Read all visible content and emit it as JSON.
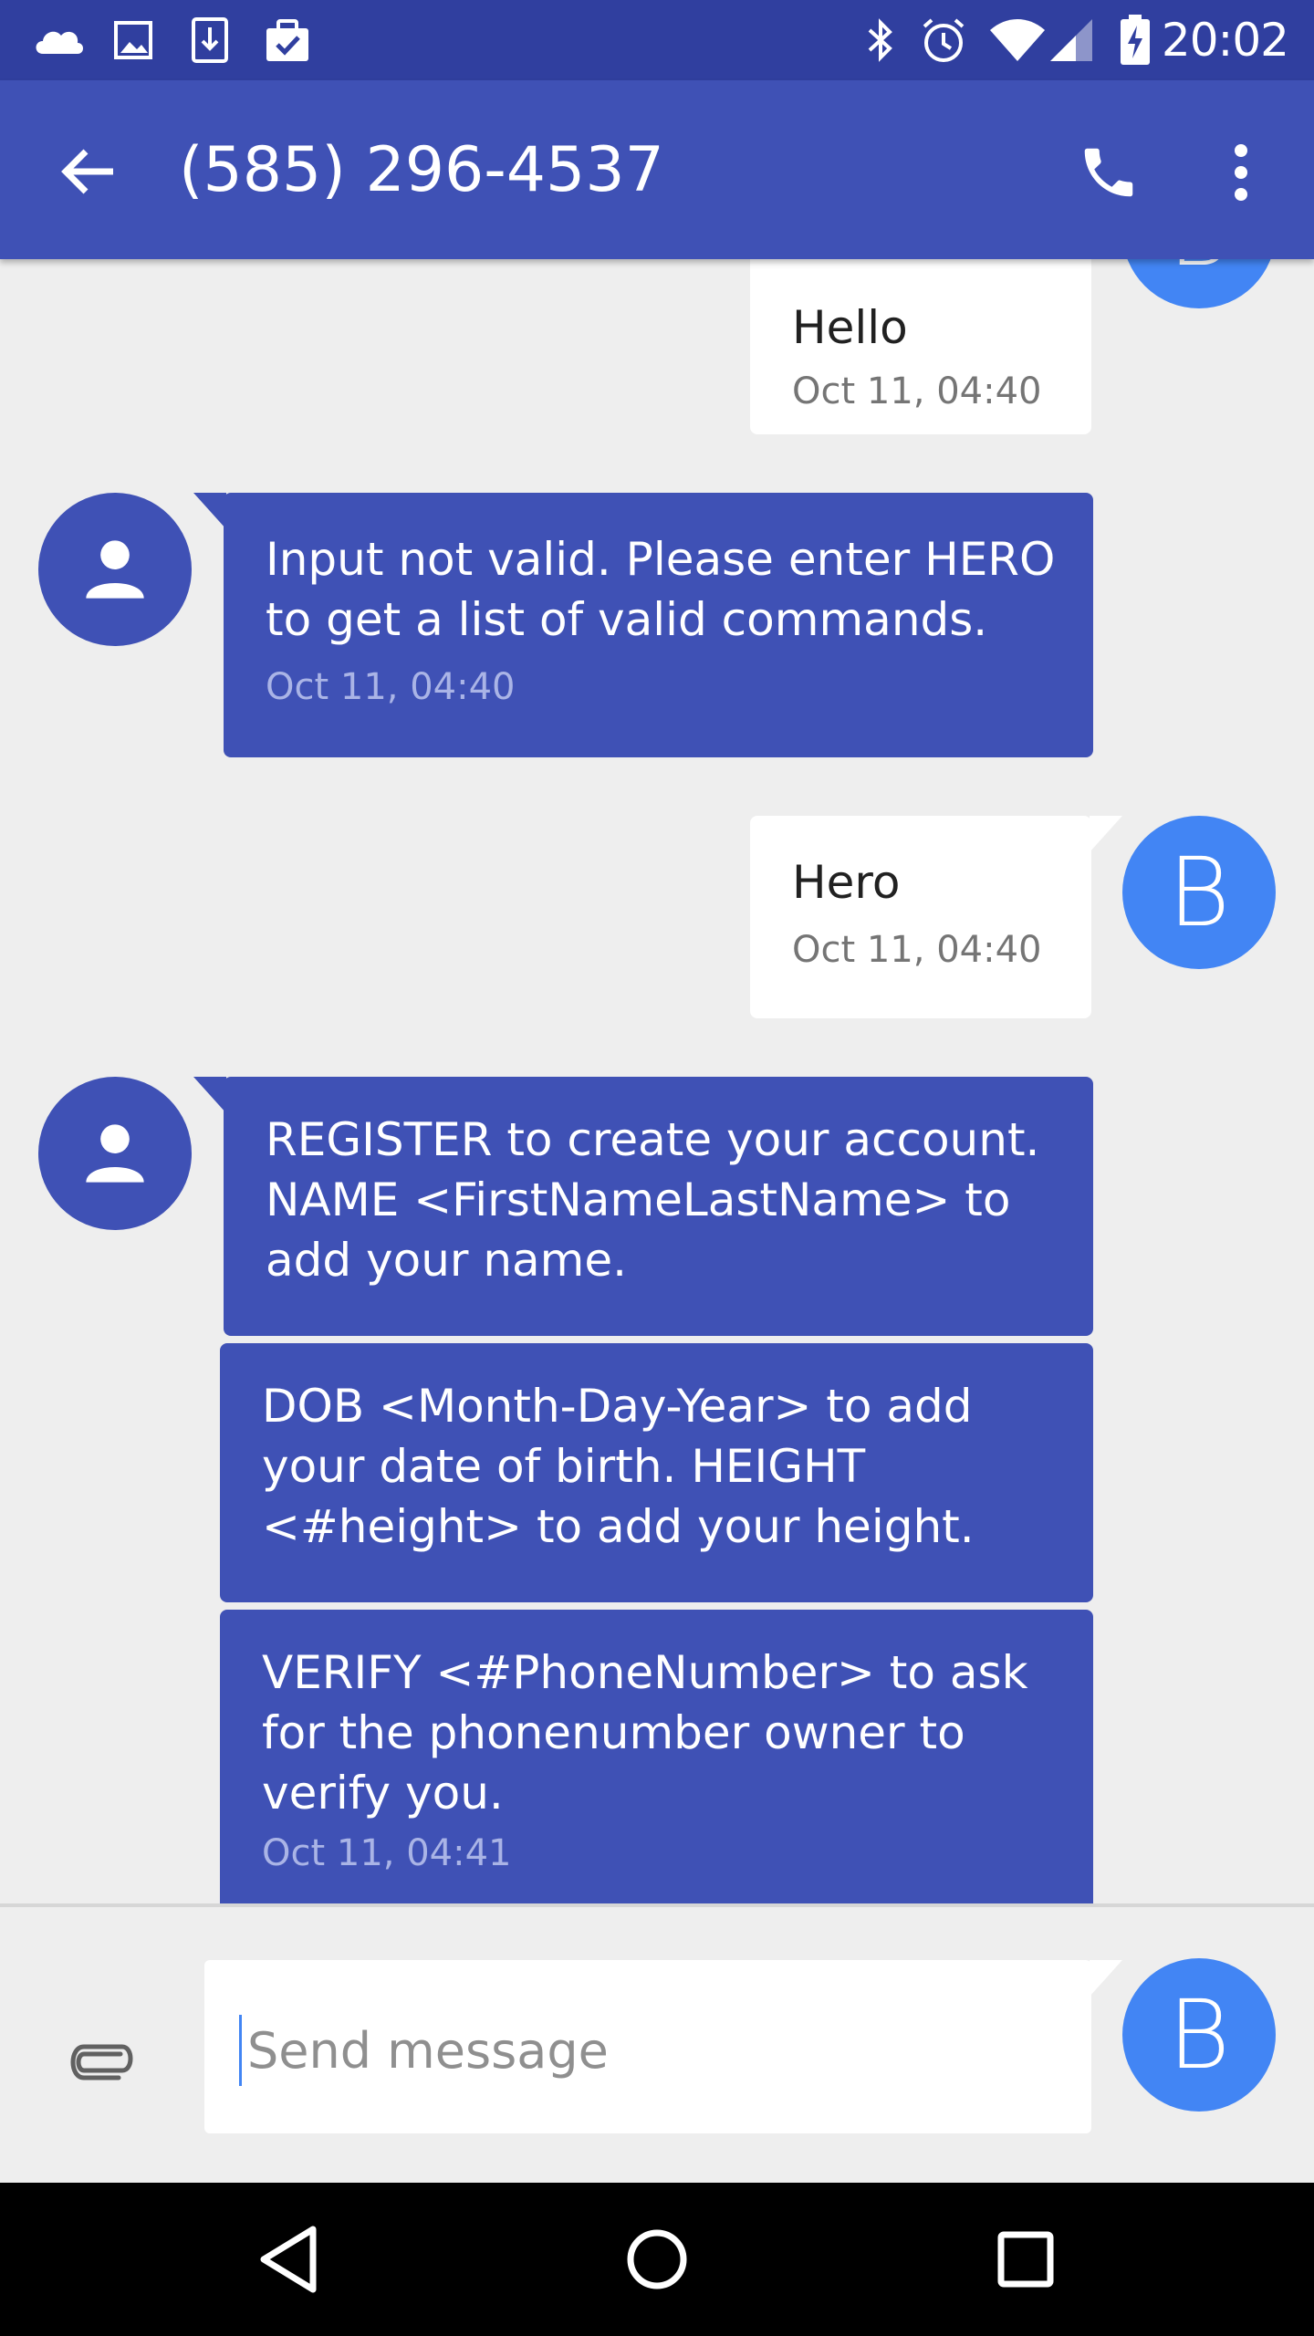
{
  "status_bar": {
    "time": "20:02",
    "icons": [
      "cloud-icon",
      "image-icon",
      "download-icon",
      "clipboard-check-icon",
      "bluetooth-icon",
      "alarm-icon",
      "wifi-icon",
      "signal-icon",
      "battery-charging-icon"
    ]
  },
  "app_bar": {
    "title": "(585) 296-4537",
    "icons": [
      "back-arrow-icon",
      "phone-icon",
      "more-vert-icon"
    ]
  },
  "contact_avatar_letter": "B",
  "messages": [
    {
      "direction": "outgoing",
      "text": "Hello",
      "timestamp": "Oct 11, 04:40"
    },
    {
      "direction": "incoming",
      "text": "Input not valid. Please enter HERO\nto get a list of valid commands.",
      "timestamp": "Oct 11, 04:40"
    },
    {
      "direction": "outgoing",
      "text": "Hero",
      "timestamp": "Oct 11, 04:40"
    },
    {
      "direction": "incoming",
      "text": "REGISTER to create your account.\nNAME <FirstNameLastName> to\nadd your name.",
      "timestamp": ""
    },
    {
      "direction": "incoming",
      "text": "DOB <Month-Day-Year> to add\nyour date of birth. HEIGHT\n<#height> to add your height.",
      "timestamp": ""
    },
    {
      "direction": "incoming",
      "text": "VERIFY <#PhoneNumber> to ask\nfor the phonenumber owner to\nverify you.",
      "timestamp": "Oct 11, 04:41"
    }
  ],
  "compose": {
    "placeholder": "Send message",
    "value": ""
  },
  "colors": {
    "status_bar": "#303f9f",
    "app_bar": "#3f51b5",
    "incoming_bubble": "#3f51b5",
    "outgoing_bubble": "#ffffff",
    "my_avatar": "#4285f4",
    "background": "#eeeeee"
  },
  "nav_bar": {
    "icons": [
      "nav-back-icon",
      "nav-home-icon",
      "nav-recents-icon"
    ]
  }
}
